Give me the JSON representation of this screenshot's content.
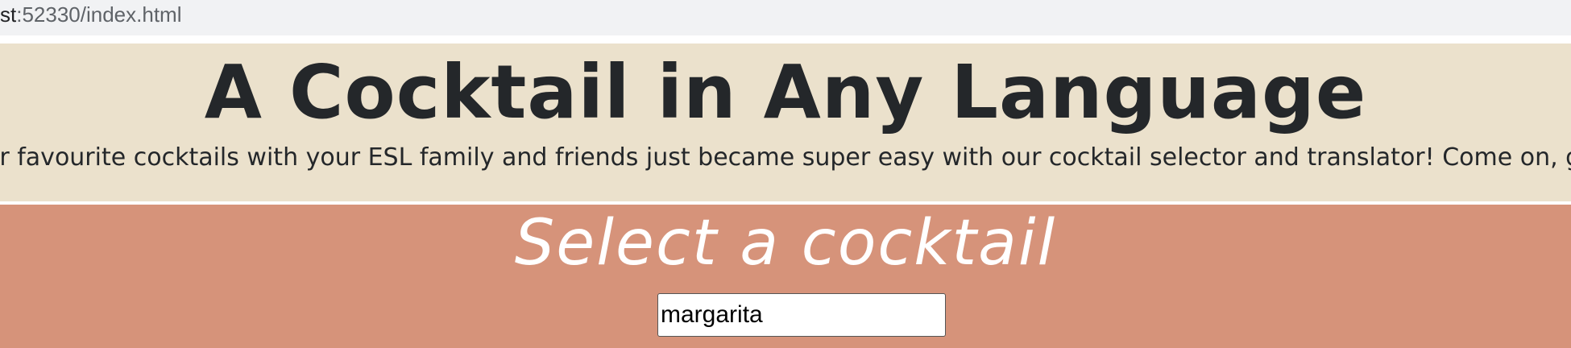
{
  "browser": {
    "url_host": "st",
    "url_path": ":52330/index.html"
  },
  "header": {
    "title": "A Cocktail in Any Language",
    "tagline": "our favourite cocktails with your ESL family and friends just became super easy with our cocktail selector and translator! Come on, give"
  },
  "select_section": {
    "heading": "Select a cocktail",
    "input_value": "margarita"
  },
  "colors": {
    "header_bg": "#ebe1cc",
    "section_bg": "#d6937a",
    "title_text": "#24272a",
    "heading_text": "#ffffff"
  }
}
